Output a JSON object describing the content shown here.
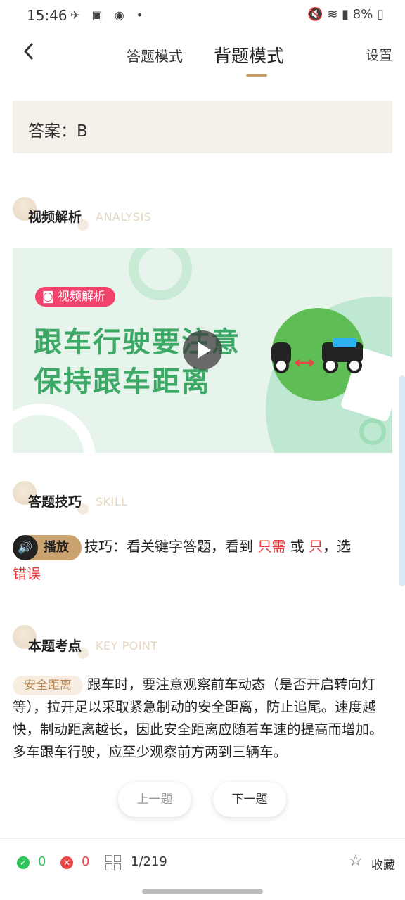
{
  "status_bar": {
    "time": "15:46",
    "battery": "8%"
  },
  "header": {
    "tabs": [
      "答题模式",
      "背题模式"
    ],
    "active_tab": 1,
    "settings_label": "设置"
  },
  "answer": {
    "text": "答案：B"
  },
  "sections": {
    "analysis": {
      "title": "视频解析",
      "en": "ANALYSIS"
    },
    "skill": {
      "title": "答题技巧",
      "en": "SKILL"
    },
    "keypoint": {
      "title": "本题考点",
      "en": "KEY POINT"
    }
  },
  "video": {
    "badge": "视频解析",
    "line1": "跟车行驶要注意",
    "line2": "保持跟车距离"
  },
  "skill": {
    "play_label": "播放",
    "text_prefix": "技巧：看关键字答题，看到",
    "hl1": "只需",
    "mid": "或",
    "hl2": "只",
    "text_suffix": "，选",
    "hl3": "错误"
  },
  "keypoint": {
    "tag": "安全距离",
    "text": "跟车时，要注意观察前车动态（是否开启转向灯等），拉开足以采取紧急制动的安全距离，防止追尾。速度越快，制动距离越长，因此安全距离应随着车速的提高而增加。多车跟车行驶，应至少观察前方两到三辆车。"
  },
  "nav": {
    "prev": "上一题",
    "next": "下一题"
  },
  "bottom": {
    "correct": "0",
    "wrong": "0",
    "pager": "1/219",
    "favorite": "收藏"
  },
  "colors": {
    "accent": "#c9a06a",
    "green": "#3ba866",
    "red": "#e83a3a"
  }
}
